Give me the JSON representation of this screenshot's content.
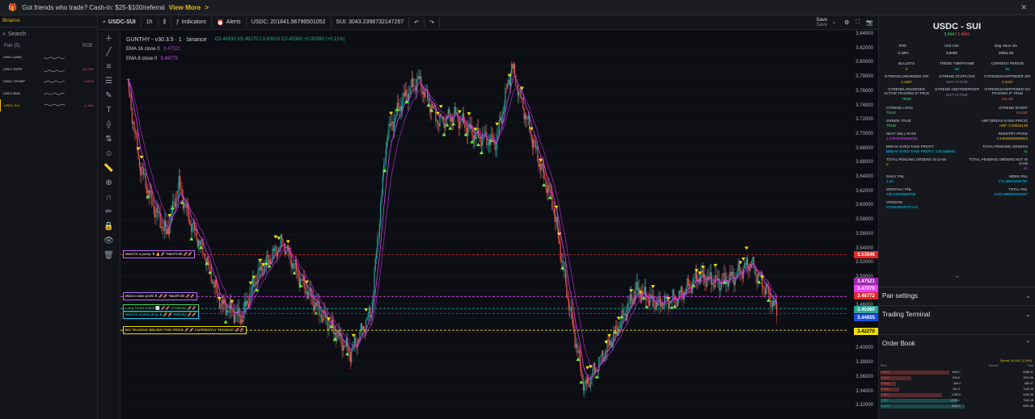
{
  "banner": {
    "icon": "gift-icon",
    "text": "Got friends who trade? Cash-in: $25-$100/referral",
    "link": "View More",
    "arrow": ">"
  },
  "left": {
    "tab": "Binance",
    "search_placeholder": "Search",
    "col_pair": "Pair (5)",
    "col_roe": "ROE",
    "pairs": [
      {
        "name": "USDC-AAVE",
        "roe": ""
      },
      {
        "name": "USDC-PEPE",
        "roe": "-16.74%"
      },
      {
        "name": "USDC-TRUMP",
        "roe": "-3.85%"
      },
      {
        "name": "USDC-BNB",
        "roe": ""
      },
      {
        "name": "USDC-SUI",
        "roe": "-1.16%"
      }
    ]
  },
  "toolbar": {
    "symbol": "USDC-SUI",
    "interval": "1h",
    "indicators": "Indicators",
    "alerts": "Alerts",
    "usdc": "USDC: 201841.96796501052",
    "sui": "SUI: 3043.2398732147267",
    "save": "Save",
    "save2": "Save"
  },
  "legend": {
    "title": "GUNTHY - v30.3.5 · 1 · binance",
    "ohlc": "O3.44930 H3.46270 L3.43620 C3.45360 +0.00390 (+0.11%)",
    "ema16": "EMA 16 close 0",
    "ema16_val": "3.47521",
    "ema8": "EMA 8 close 0",
    "ema8_val": "3.46772"
  },
  "annotations": [
    {
      "text": "Wait for a pump ⬆ 🔥🚀 TakeProfit 🚀🚀",
      "color": "#c070ff"
    },
    {
      "text": "Wait to take profit ⬆ 🚀🚀 TakeProfit 🚀🚀",
      "color": "#c070ff"
    },
    {
      "text": "Long Trend Active 📈 🚀🚀 GTREND 🚀🚀",
      "color": "#4cd964"
    },
    {
      "text": "Wait for market drop ⬇ 🚀🚀 ReEntry 🚀🚀",
      "color": "#00d1ff"
    },
    {
      "text": "NO TRADING BELOW THIS PRICE 🚀🚀 CURRENTLY TRADING 🚀🚀",
      "color": "#f0e000"
    }
  ],
  "price_axis": [
    "3.84000",
    "3.82000",
    "3.80000",
    "3.78000",
    "3.76000",
    "3.74000",
    "3.72000",
    "3.70000",
    "3.68000",
    "3.66000",
    "3.64000",
    "3.62000",
    "3.60000",
    "3.58000",
    "3.56000",
    "3.54000",
    "3.52000",
    "3.50000",
    "3.48000",
    "3.46000",
    "3.44000",
    "3.42000",
    "3.40000",
    "3.38000",
    "3.36000",
    "3.34000",
    "3.32000"
  ],
  "price_boxes": [
    {
      "value": "3.53046",
      "color": "#e02828"
    },
    {
      "value": "3.47521",
      "color": "#9c27b0"
    },
    {
      "value": "3.47070",
      "color": "#e040fb"
    },
    {
      "value": "3.46772",
      "color": "#e02828"
    },
    {
      "value": "3.45360",
      "color": "#26a69a"
    },
    {
      "value": "3.44655",
      "color": "#1a4ee0"
    },
    {
      "value": "3.42270",
      "color": "#f0e000"
    }
  ],
  "panel": {
    "title": "USDC - SUI",
    "sub_green": "3.454",
    "sub_sep": " / ",
    "sub_red": "3.4541",
    "roe_label": "ROE",
    "roe_value": "-1.16%",
    "unit_cost_label": "Unit cost",
    "unit_cost_value": "3.5083",
    "bag_label": "Bag value n/a",
    "bag_value": "10511.55",
    "grid3": [
      {
        "label": "BULLETS",
        "value": "0",
        "color": "y"
      },
      {
        "label": "TREND TIMEFRAME",
        "value": "60",
        "color": "c1"
      },
      {
        "label": "CURRENT PERIOD",
        "value": "60",
        "color": "c1"
      },
      {
        "label": "GTRENDLONGRIDER S/R",
        "value": "3.4687",
        "color": "y"
      },
      {
        "label": "GTREND STOPLOSS",
        "value": "NOT ACTIVE",
        "color": "gray"
      },
      {
        "label": "GTRENDSHORTRIDER S/R",
        "value": "3.4257",
        "color": "y"
      },
      {
        "label": "GTRENDLONGRIDER ACTIVE TRADING IF TRUE",
        "value": "TRUE",
        "color": "g"
      },
      {
        "label": "GTREND ONETIMERIDER",
        "value": "NOT ACTIVE",
        "color": "gray"
      },
      {
        "label": "GTRENDSHORTRIDER NO TRADING IF TRUE",
        "value": "FALSE",
        "color": "rd"
      }
    ],
    "grid2": [
      {
        "label": "GTREND LONG",
        "value": "TRUE",
        "color": "g"
      },
      {
        "label": "GTREND SHORT",
        "value": "FALSE",
        "color": "rd"
      },
      {
        "label": "GREEN: TRUE",
        "value": "TRUE",
        "color": "g"
      },
      {
        "label": "ABP (BREAK-EVEN PRICE)",
        "value": "ABP: 3.50834138",
        "color": "y"
      },
      {
        "label": "NEXT SELL RATE",
        "value": "3.47878693686082",
        "color": "mg"
      },
      {
        "label": "REENTRY PRICE",
        "value": "3.44655809998863",
        "color": "y"
      },
      {
        "label": "BREAK EVEN TAKE PROFIT",
        "value": "BREAK EVEN TAKE PROFIT: 3.50189946",
        "color": "c1"
      },
      {
        "label": "TOTAL PENDING ORDERS",
        "value": "41",
        "color": "g"
      },
      {
        "label": "TOTAL PENDING ORDERS IN GAIN",
        "value": "0",
        "color": "y"
      },
      {
        "label": "TOTAL PENDING ORDERS NOT IN GAIN",
        "value": "41",
        "color": "mg"
      },
      {
        "label": "DAILY PNL",
        "value": "1.34",
        "color": "c1"
      },
      {
        "label": "WEEK PNL",
        "value": "171.58829292797",
        "color": "c1"
      },
      {
        "label": "MONTHLY PNL",
        "value": "739.21623893799",
        "color": "c1"
      },
      {
        "label": "TOTAL PNL",
        "value": "2100.888622023447",
        "color": "c1"
      },
      {
        "label": "VERSION",
        "value": "GTRENDSPOT 5.9",
        "color": "c1"
      }
    ],
    "pair_settings": "Pair settings",
    "trading_terminal": "Trading Terminal",
    "order_book": "Order Book",
    "spread": "Spread: $0.0001 (0.00%)",
    "ob_price": "Price",
    "ob_amount": "Amount",
    "ob_total": "Total",
    "ob_rows": [
      {
        "price": "3.4545",
        "amount": "1942.7",
        "total": "6388.41",
        "side": "ask",
        "fill": 0.45
      },
      {
        "price": "3.4544",
        "amount": "616.8",
        "total": "2021.56",
        "side": "ask",
        "fill": 0.2
      },
      {
        "price": "3.4543",
        "amount": "269.4",
        "total": "886.07",
        "side": "ask",
        "fill": 0.1
      },
      {
        "price": "3.4542",
        "amount": "351.9",
        "total": "1145.15",
        "side": "ask",
        "fill": 0.12
      },
      {
        "price": "3.4541",
        "amount": "1785.5",
        "total": "6180.36",
        "side": "ask",
        "fill": 0.4
      },
      {
        "price": "3.454",
        "amount": "2123.1",
        "total": "7333.15",
        "side": "bid",
        "fill": 0.5
      },
      {
        "price": "3.4539",
        "amount": "2432.7",
        "total": "8402.36",
        "side": "bid",
        "fill": 0.55
      }
    ]
  },
  "colors": {
    "up": "#26a69a",
    "down": "#ef5350",
    "accent": "#f0b90b"
  }
}
